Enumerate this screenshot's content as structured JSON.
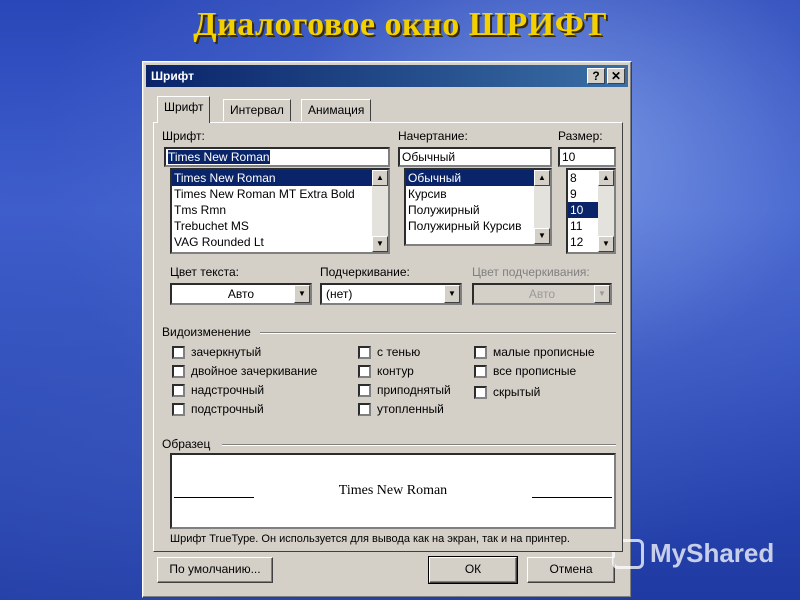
{
  "slide": {
    "title": "Диалоговое окно  ШРИФТ"
  },
  "dialog": {
    "title": "Шрифт",
    "help_label": "?",
    "close_label": "✕",
    "tabs": [
      {
        "label": "Шрифт",
        "active": true
      },
      {
        "label": "Интервал",
        "active": false
      },
      {
        "label": "Анимация",
        "active": false
      }
    ],
    "font": {
      "label": "Шрифт:",
      "value": "Times New Roman",
      "items": [
        "Times New Roman",
        "Times New Roman MT Extra Bold",
        "Tms Rmn",
        "Trebuchet MS",
        "VAG Rounded Lt"
      ],
      "selected_index": 0
    },
    "style": {
      "label": "Начертание:",
      "value": "Обычный",
      "items": [
        "Обычный",
        "Курсив",
        "Полужирный",
        "Полужирный Курсив"
      ],
      "selected_index": 0
    },
    "size": {
      "label": "Размер:",
      "value": "10",
      "items": [
        "8",
        "9",
        "10",
        "11",
        "12"
      ],
      "selected_index": 2
    },
    "text_color": {
      "label": "Цвет текста:",
      "value": "Авто"
    },
    "underline": {
      "label": "Подчеркивание:",
      "value": "(нет)"
    },
    "underline_color": {
      "label": "Цвет подчеркивания:",
      "value": "Авто",
      "disabled": true
    },
    "effects": {
      "label": "Видоизменение",
      "col1": [
        "зачеркнутый",
        "двойное зачеркивание",
        "надстрочный",
        "подстрочный"
      ],
      "col2": [
        "с тенью",
        "контур",
        "приподнятый",
        "утопленный"
      ],
      "col3": [
        "малые прописные",
        "все прописные",
        "скрытый"
      ]
    },
    "preview": {
      "label": "Образец",
      "sample_text": "Times New Roman",
      "note": "Шрифт TrueType. Он используется для вывода как на экран, так и на принтер."
    },
    "buttons": {
      "default_label": "По умолчанию...",
      "ok_label": "ОК",
      "cancel_label": "Отмена"
    }
  },
  "watermark": {
    "text": "MyShared"
  },
  "colors": {
    "title_yellow": "#f3d100",
    "dialog_face": "#d4d0c8",
    "titlebar_start": "#0a246a",
    "titlebar_end": "#3a6ea5",
    "selection": "#0a246a"
  }
}
